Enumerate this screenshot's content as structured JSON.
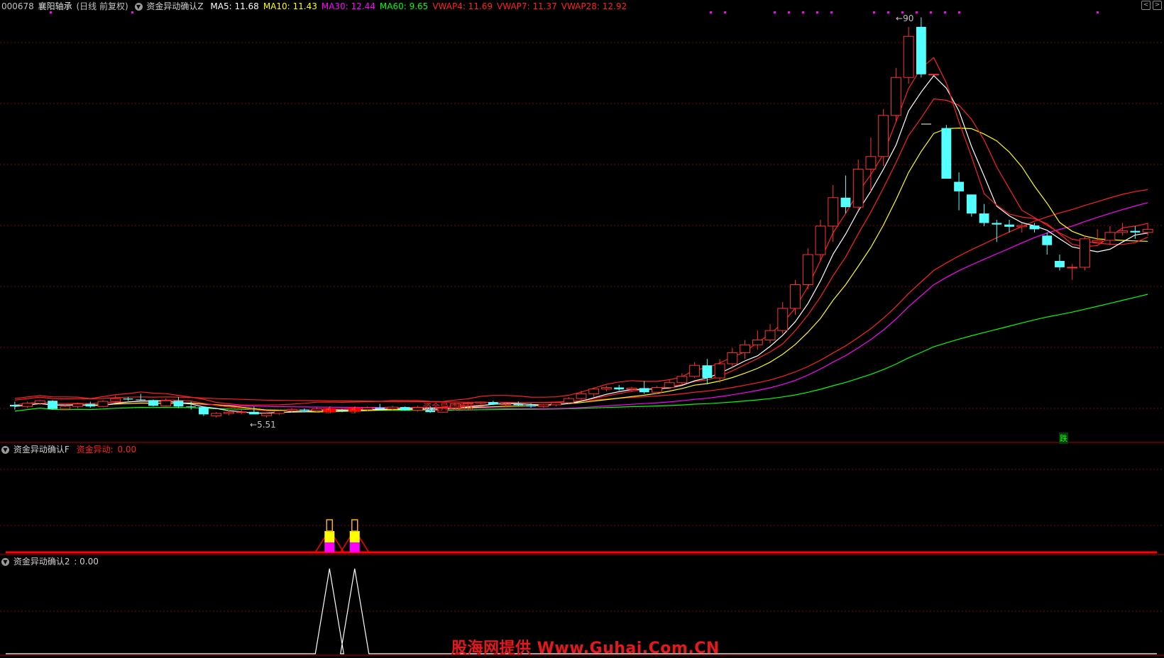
{
  "header": {
    "code": "000678",
    "name": "襄阳轴承",
    "period": "(日线 前复权)",
    "indicator": "资金异动确认Z",
    "ma": [
      {
        "label": "MA5:",
        "value": "11.68",
        "color": "#ffffff"
      },
      {
        "label": "MA10:",
        "value": "11.43",
        "color": "#ffff00"
      },
      {
        "label": "MA30:",
        "value": "12.44",
        "color": "#ff00ff"
      },
      {
        "label": "MA60:",
        "value": "9.65",
        "color": "#00ff00"
      },
      {
        "label": "VWAP4:",
        "value": "11.69",
        "color": "#ff2020"
      },
      {
        "label": "VWAP7:",
        "value": "11.37",
        "color": "#ff2020"
      },
      {
        "label": "VWAP28:",
        "value": "12.92",
        "color": "#ff2020"
      }
    ]
  },
  "panel1": {
    "high_label": "90",
    "low_label": "5.51",
    "signal_label": "资金异动确认",
    "sell_label": "跌"
  },
  "panel2": {
    "title": "资金异动确认F",
    "series_label": "资金异动:",
    "series_value": "0.00"
  },
  "panel3": {
    "title": "资金异动确认2",
    "value": ": 0.00"
  },
  "watermark": "股海网提供 Www.Guhai.Com.CN",
  "colors": {
    "up": "#ff3232",
    "down": "#54ffff",
    "ma5": "#ffffff",
    "ma10": "#ffff00",
    "ma30": "#ff00ff",
    "ma60": "#00ff00",
    "vwap": "#ff2020",
    "grid": "#7a0000"
  },
  "chart_data": {
    "type": "candlestick",
    "candles": [
      [
        5.85,
        5.95,
        5.7,
        5.8
      ],
      [
        5.8,
        5.95,
        5.75,
        5.9
      ],
      [
        5.9,
        6.0,
        5.85,
        5.98
      ],
      [
        5.98,
        6.0,
        5.7,
        5.72
      ],
      [
        5.72,
        5.85,
        5.68,
        5.8
      ],
      [
        5.8,
        5.92,
        5.74,
        5.88
      ],
      [
        5.88,
        5.95,
        5.76,
        5.8
      ],
      [
        5.8,
        6.0,
        5.78,
        5.96
      ],
      [
        5.96,
        6.15,
        5.9,
        6.05
      ],
      [
        6.05,
        6.1,
        5.98,
        6.02
      ],
      [
        6.02,
        6.2,
        5.96,
        6.0
      ],
      [
        6.0,
        6.02,
        5.8,
        5.82
      ],
      [
        5.82,
        6.05,
        5.8,
        5.98
      ],
      [
        5.98,
        6.1,
        5.75,
        5.8
      ],
      [
        5.8,
        5.95,
        5.7,
        5.78
      ],
      [
        5.78,
        5.78,
        5.5,
        5.55
      ],
      [
        5.5,
        5.62,
        5.45,
        5.58
      ],
      [
        5.58,
        5.68,
        5.52,
        5.62
      ],
      [
        5.62,
        5.7,
        5.55,
        5.63
      ],
      [
        5.63,
        5.8,
        5.55,
        5.55
      ],
      [
        5.51,
        5.62,
        5.45,
        5.58
      ],
      [
        5.58,
        5.68,
        5.54,
        5.66
      ],
      [
        5.66,
        5.75,
        5.6,
        5.7
      ],
      [
        5.7,
        5.74,
        5.62,
        5.66
      ],
      [
        5.66,
        5.78,
        5.62,
        5.72
      ],
      [
        5.72,
        5.76,
        5.64,
        5.68
      ],
      [
        5.68,
        5.72,
        5.62,
        5.66
      ],
      [
        5.66,
        5.74,
        5.6,
        5.7
      ],
      [
        5.7,
        5.8,
        5.66,
        5.76
      ],
      [
        5.76,
        5.88,
        5.7,
        5.72
      ],
      [
        5.72,
        5.82,
        5.68,
        5.78
      ],
      [
        5.78,
        5.8,
        5.66,
        5.68
      ],
      [
        5.68,
        5.82,
        5.64,
        5.76
      ],
      [
        5.76,
        5.8,
        5.6,
        5.62
      ],
      [
        5.62,
        5.78,
        5.6,
        5.75
      ],
      [
        5.75,
        5.9,
        5.7,
        5.88
      ],
      [
        5.88,
        5.95,
        5.84,
        5.91
      ],
      [
        5.91,
        5.96,
        5.86,
        5.94
      ],
      [
        5.94,
        5.98,
        5.84,
        5.86
      ],
      [
        5.86,
        5.92,
        5.8,
        5.88
      ],
      [
        5.88,
        5.96,
        5.8,
        5.84
      ],
      [
        5.84,
        5.9,
        5.76,
        5.8
      ],
      [
        5.8,
        5.88,
        5.76,
        5.85
      ],
      [
        5.85,
        5.95,
        5.8,
        5.92
      ],
      [
        5.92,
        6.1,
        5.88,
        6.05
      ],
      [
        6.05,
        6.3,
        6.0,
        6.2
      ],
      [
        6.2,
        6.4,
        6.1,
        6.35
      ],
      [
        6.35,
        6.45,
        6.28,
        6.4
      ],
      [
        6.4,
        6.48,
        6.3,
        6.34
      ],
      [
        6.34,
        6.42,
        6.26,
        6.38
      ],
      [
        6.38,
        6.6,
        6.2,
        6.25
      ],
      [
        6.25,
        6.45,
        6.2,
        6.4
      ],
      [
        6.4,
        6.65,
        6.35,
        6.55
      ],
      [
        6.55,
        6.85,
        6.5,
        6.75
      ],
      [
        6.75,
        7.2,
        6.7,
        7.1
      ],
      [
        7.1,
        7.3,
        6.5,
        6.7
      ],
      [
        6.7,
        7.3,
        6.55,
        7.15
      ],
      [
        7.15,
        7.65,
        7.0,
        7.5
      ],
      [
        7.5,
        7.9,
        7.3,
        7.75
      ],
      [
        7.75,
        8.2,
        7.6,
        7.9
      ],
      [
        7.9,
        8.4,
        7.8,
        8.2
      ],
      [
        8.2,
        9.1,
        8.1,
        8.9
      ],
      [
        8.9,
        9.8,
        8.7,
        9.65
      ],
      [
        9.65,
        10.8,
        9.5,
        10.6
      ],
      [
        10.6,
        11.7,
        10.4,
        11.5
      ],
      [
        11.5,
        12.8,
        11.0,
        12.4
      ],
      [
        12.4,
        13.1,
        11.9,
        12.1
      ],
      [
        12.1,
        13.6,
        12.0,
        13.3
      ],
      [
        13.3,
        14.3,
        12.6,
        13.7
      ],
      [
        13.7,
        15.2,
        13.4,
        15.0
      ],
      [
        15.0,
        16.5,
        14.8,
        16.2
      ],
      [
        16.2,
        17.8,
        16.0,
        17.5
      ],
      [
        17.8,
        18.1,
        16.2,
        16.3
      ],
      [
        16.3,
        16.3,
        16.3,
        16.3
      ],
      [
        14.6,
        14.7,
        13.0,
        13.0
      ],
      [
        12.9,
        13.2,
        12.0,
        12.6
      ],
      [
        12.5,
        12.5,
        11.8,
        11.9
      ],
      [
        11.9,
        12.2,
        11.5,
        11.6
      ],
      [
        11.6,
        11.7,
        11.0,
        11.55
      ],
      [
        11.55,
        11.7,
        11.3,
        11.48
      ],
      [
        11.48,
        11.6,
        11.3,
        11.52
      ],
      [
        11.52,
        11.6,
        11.3,
        11.4
      ],
      [
        11.2,
        11.3,
        10.6,
        10.9
      ],
      [
        10.4,
        10.6,
        10.1,
        10.2
      ],
      [
        10.2,
        10.3,
        9.8,
        10.2
      ],
      [
        10.2,
        11.2,
        10.1,
        11.1
      ],
      [
        11.0,
        11.4,
        11.0,
        11.05
      ],
      [
        11.05,
        11.5,
        10.9,
        11.3
      ],
      [
        11.3,
        11.6,
        11.2,
        11.35
      ],
      [
        11.35,
        11.5,
        11.1,
        11.3
      ],
      [
        11.3,
        11.6,
        11.2,
        11.4
      ]
    ],
    "signal_index": [
      25,
      27
    ],
    "high_value": "90",
    "low_value": "5.51",
    "ylim": [
      5.2,
      18.2
    ]
  }
}
